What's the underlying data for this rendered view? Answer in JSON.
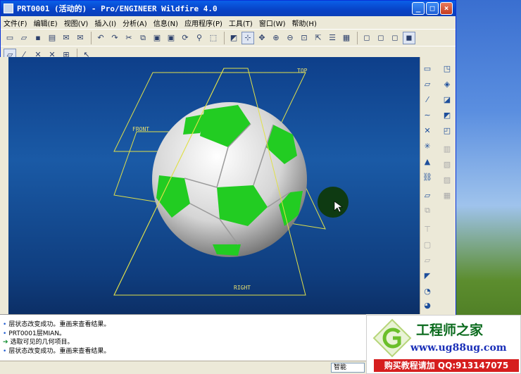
{
  "window": {
    "title": "PRT0001 (活动的) - Pro/ENGINEER Wildfire 4.0"
  },
  "menu": [
    "文件(F)",
    "编辑(E)",
    "视图(V)",
    "插入(I)",
    "分析(A)",
    "信息(N)",
    "应用程序(P)",
    "工具(T)",
    "窗口(W)",
    "帮助(H)"
  ],
  "planes": {
    "top": "TOP",
    "front": "FRONT",
    "right": "RIGHT"
  },
  "messages": [
    {
      "icon": "bullet",
      "text": "层状态改变成功。重画来查看结果。"
    },
    {
      "icon": "bullet",
      "text": "PRT0001层MIAN。"
    },
    {
      "icon": "arrow",
      "text": "选取可见的几何项目。"
    },
    {
      "icon": "bullet",
      "text": "层状态改变成功。重画来查看结果。"
    }
  ],
  "filter": {
    "value": "智能"
  },
  "ad": {
    "title": "工程师之家",
    "url": "www.ug88ug.com",
    "banner": "购买教程请加 QQ:913147075"
  },
  "colors": {
    "titlebar": "#0842c6",
    "viewport": "#1a5aa6",
    "plane": "#e0e04a",
    "ball_green": "#22cc22"
  }
}
